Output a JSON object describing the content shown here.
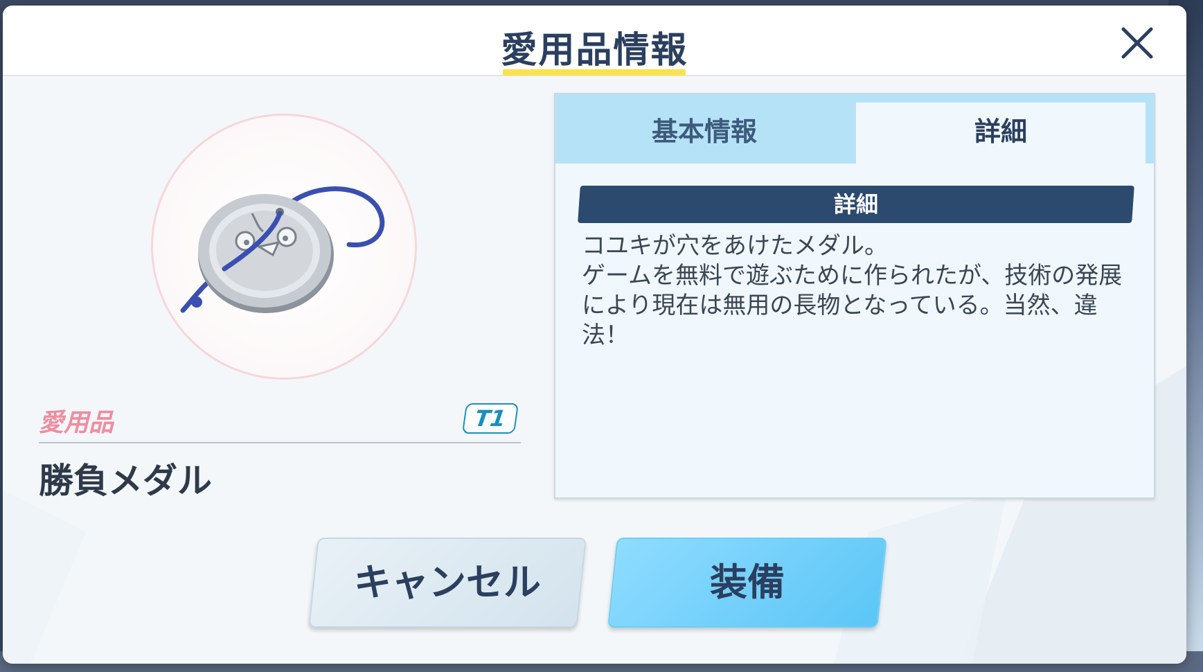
{
  "dialog": {
    "title": "愛用品情報"
  },
  "item": {
    "category": "愛用品",
    "tier": "T1",
    "name": "勝負メダル"
  },
  "tabs": [
    {
      "label": "基本情報",
      "active": false
    },
    {
      "label": "詳細",
      "active": true
    }
  ],
  "detail": {
    "section_title": "詳細",
    "description": "コユキが穴をあけたメダル。\nゲームを無料で遊ぶために作られたが、技術の発展\nにより現在は無用の長物となっている。当然、違\n法！"
  },
  "buttons": {
    "cancel_label": "キャンセル",
    "equip_label": "装備"
  },
  "colors": {
    "title": "#2b3f5f",
    "accent_yellow": "#fce24a",
    "category_pink": "#f08c9f",
    "tier_blue": "#1a8fbd",
    "section_bar": "#2b4a6e",
    "equip_button": "#5cc6f6"
  }
}
